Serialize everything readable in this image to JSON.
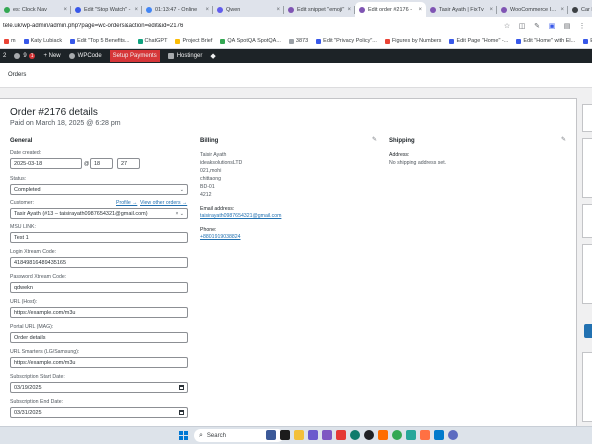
{
  "browser": {
    "tabs": [
      {
        "title": "es: Clock Nav",
        "color": "#34a853",
        "active": false
      },
      {
        "title": "Edit \"Stop Watch\" -",
        "color": "#3858e9",
        "active": false
      },
      {
        "title": "01:13:47 - Online",
        "color": "#4285f4",
        "active": false
      },
      {
        "title": "Qwen",
        "color": "#615ced",
        "active": false
      },
      {
        "title": "Edit snippet \"emoji\"",
        "color": "#7f54b3",
        "active": false
      },
      {
        "title": "Edit order #2176 -",
        "color": "#7f54b3",
        "active": true
      },
      {
        "title": "Tasir Ayath | FixTv",
        "color": "#7f54b3",
        "active": false
      },
      {
        "title": "WooCommerce IPTV",
        "color": "#7f54b3",
        "active": false
      },
      {
        "title": "Car Keys Re",
        "color": "#3c4043",
        "active": false
      }
    ],
    "url": "tele.uk/wp-admin/admin.php?page=wc-orders&action=edit&id=2176",
    "bookmarks": [
      {
        "label": "m",
        "color": "#ea4335"
      },
      {
        "label": "Katy Lubiack",
        "color": "#3858e9"
      },
      {
        "label": "Edit \"Top 5 Benefits...",
        "color": "#3858e9"
      },
      {
        "label": "ChatGPT",
        "color": "#10a37f"
      },
      {
        "label": "Project Brief",
        "color": "#fbbc04"
      },
      {
        "label": "QA SpotQA SpotQA...",
        "color": "#34a853"
      },
      {
        "label": "3873",
        "color": "#9aa0a6"
      },
      {
        "label": "Edit \"Privacy Policy\"...",
        "color": "#3858e9"
      },
      {
        "label": "Figures by Numbers",
        "color": "#ea4335"
      },
      {
        "label": "Edit Page \"Home\" -...",
        "color": "#3858e9"
      },
      {
        "label": "Edit \"Home\" with El...",
        "color": "#3858e9"
      },
      {
        "label": "Edit Post \"KUR",
        "color": "#3858e9"
      }
    ]
  },
  "adminbar": {
    "items": [
      "2",
      "9",
      "+ New",
      "WPCode",
      "Setup Payments",
      "Hostinger"
    ],
    "badge": "1"
  },
  "page": {
    "header": "Orders",
    "order_title": "Order #2176 details",
    "order_sub": "Paid on March 18, 2025 @ 6:28 pm"
  },
  "general": {
    "heading": "General",
    "date_label": "Date created:",
    "date": "2025-03-18",
    "at": "@",
    "hour": "18",
    "minute": "27",
    "status_label": "Status:",
    "status": "Completed",
    "customer_label": "Customer:",
    "profile_link": "Profile →",
    "view_orders_link": "View other orders →",
    "customer": "Tasir Ayath (#13 – taisirayath0987654321@gmail.com)",
    "msu_label": "MSU LINK:",
    "msu": "Test 1",
    "xtream_code_label": "Login Xtream Code:",
    "xtream_code": "41849816489435165",
    "password_label": "Password Xtream Code:",
    "password": "qdwekn",
    "url_host_label": "URL (Host):",
    "url_host": "https://example.com/m3u",
    "portal_label": "Portal URL (MAG):",
    "portal": "Order details",
    "smarters_label": "URL Smarters (LG/Samsung):",
    "smarters": "https://example.com/m3u",
    "sub_start_label": "Subscription Start Date:",
    "sub_start": "03/19/2025",
    "sub_end_label": "Subscription End Date:",
    "sub_end": "03/31/2025"
  },
  "billing": {
    "heading": "Billing",
    "lines": [
      "Taisir Ayath",
      "ideaksolutionsLTD",
      "021,mohi",
      "chittaong",
      "BD-01",
      "4212"
    ],
    "email_label": "Email address:",
    "email": "taisirayath0987654321@gmail.com",
    "phone_label": "Phone:",
    "phone": "+8801919038824"
  },
  "shipping": {
    "heading": "Shipping",
    "address_label": "Address:",
    "address": "No shipping address set."
  },
  "taskbar": {
    "search_placeholder": "Search"
  }
}
